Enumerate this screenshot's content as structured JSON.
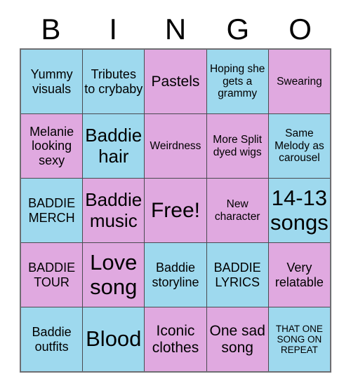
{
  "card": {
    "header_letters": [
      "B",
      "I",
      "N",
      "G",
      "O"
    ],
    "colors": {
      "blue": "#9ed9ee",
      "pink": "#e0a9e0",
      "border": "#4a4a50",
      "outer_border": "#6e6e72",
      "text": "#000000",
      "background": "#ffffff"
    },
    "rows": [
      [
        {
          "text": "Yummy visuals",
          "color": "blue",
          "size": "md"
        },
        {
          "text": "Tributes to crybaby",
          "color": "blue",
          "size": "md"
        },
        {
          "text": "Pastels",
          "color": "pink",
          "size": "lg"
        },
        {
          "text": "Hoping she gets a grammy",
          "color": "blue",
          "size": "sm"
        },
        {
          "text": "Swearing",
          "color": "pink",
          "size": "sm"
        }
      ],
      [
        {
          "text": "Melanie looking sexy",
          "color": "pink",
          "size": "md"
        },
        {
          "text": "Baddie hair",
          "color": "blue",
          "size": "xl"
        },
        {
          "text": "Weirdness",
          "color": "pink",
          "size": "sm"
        },
        {
          "text": "More Split dyed wigs",
          "color": "pink",
          "size": "sm"
        },
        {
          "text": "Same Melody as carousel",
          "color": "blue",
          "size": "sm"
        }
      ],
      [
        {
          "text": "BADDIE MERCH",
          "color": "blue",
          "size": "md"
        },
        {
          "text": "Baddie music",
          "color": "pink",
          "size": "xl"
        },
        {
          "text": "Free!",
          "color": "pink",
          "size": "free"
        },
        {
          "text": "New character",
          "color": "pink",
          "size": "sm"
        },
        {
          "text": "14-13 songs",
          "color": "blue",
          "size": "xxl"
        }
      ],
      [
        {
          "text": "BADDIE TOUR",
          "color": "pink",
          "size": "md"
        },
        {
          "text": "Love song",
          "color": "pink",
          "size": "xxl"
        },
        {
          "text": "Baddie storyline",
          "color": "blue",
          "size": "md"
        },
        {
          "text": "BADDIE LYRICS",
          "color": "blue",
          "size": "md"
        },
        {
          "text": "Very relatable",
          "color": "pink",
          "size": "md"
        }
      ],
      [
        {
          "text": "Baddie outfits",
          "color": "blue",
          "size": "md"
        },
        {
          "text": "Blood",
          "color": "blue",
          "size": "xxl"
        },
        {
          "text": "Iconic clothes",
          "color": "pink",
          "size": "lg"
        },
        {
          "text": "One sad song",
          "color": "pink",
          "size": "lg"
        },
        {
          "text": "THAT ONE SONG ON REPEAT",
          "color": "blue",
          "size": "xs"
        }
      ]
    ]
  }
}
